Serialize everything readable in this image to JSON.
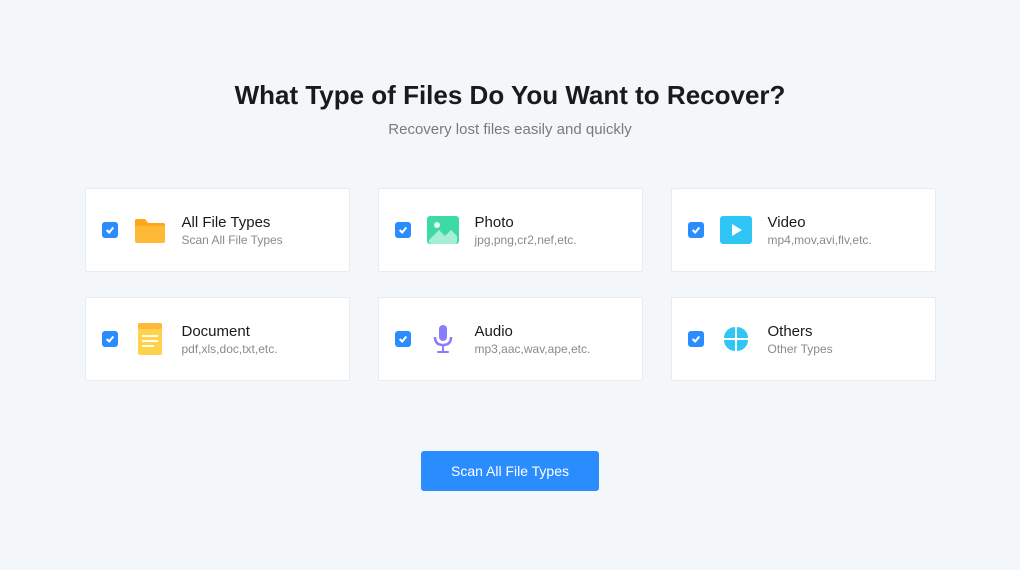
{
  "header": {
    "title": "What Type of Files Do You Want to Recover?",
    "subtitle": "Recovery lost files easily and quickly"
  },
  "cards": [
    {
      "title": "All File Types",
      "sub": "Scan All File Types"
    },
    {
      "title": "Photo",
      "sub": "jpg,png,cr2,nef,etc."
    },
    {
      "title": "Video",
      "sub": "mp4,mov,avi,flv,etc."
    },
    {
      "title": "Document",
      "sub": "pdf,xls,doc,txt,etc."
    },
    {
      "title": "Audio",
      "sub": "mp3,aac,wav,ape,etc."
    },
    {
      "title": "Others",
      "sub": "Other Types"
    }
  ],
  "button": {
    "label": "Scan All File Types"
  }
}
